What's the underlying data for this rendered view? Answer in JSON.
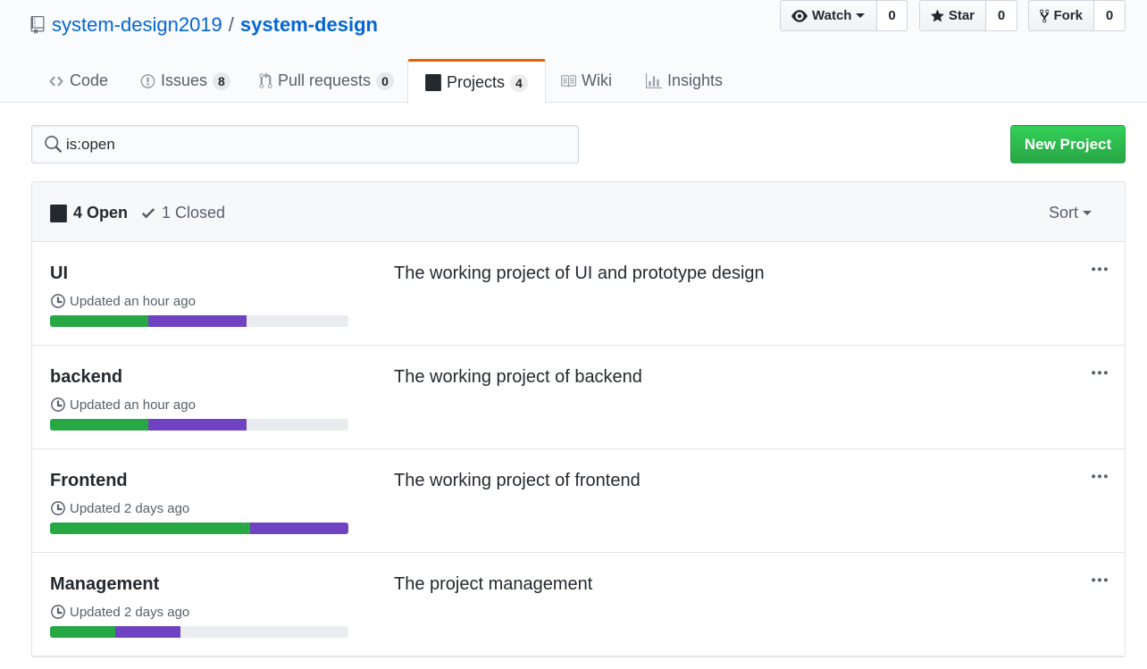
{
  "repo": {
    "owner": "system-design2019",
    "separator": "/",
    "name": "system-design"
  },
  "actions": {
    "watch": {
      "label": "Watch",
      "count": "0"
    },
    "star": {
      "label": "Star",
      "count": "0"
    },
    "fork": {
      "label": "Fork",
      "count": "0"
    }
  },
  "nav": {
    "code": {
      "label": "Code"
    },
    "issues": {
      "label": "Issues",
      "count": "8"
    },
    "pulls": {
      "label": "Pull requests",
      "count": "0"
    },
    "projects": {
      "label": "Projects",
      "count": "4"
    },
    "wiki": {
      "label": "Wiki"
    },
    "insights": {
      "label": "Insights"
    }
  },
  "search": {
    "value": "is:open"
  },
  "new_project_label": "New Project",
  "filters": {
    "open_label": "4 Open",
    "closed_label": "1 Closed",
    "sort_label": "Sort"
  },
  "projects": [
    {
      "name": "UI",
      "updated": "Updated an hour ago",
      "description": "The working project of UI and prototype design",
      "progress": {
        "done": 0.33,
        "in_progress": 0.33
      }
    },
    {
      "name": "backend",
      "updated": "Updated an hour ago",
      "description": "The working project of backend",
      "progress": {
        "done": 0.33,
        "in_progress": 0.33
      }
    },
    {
      "name": "Frontend",
      "updated": "Updated 2 days ago",
      "description": "The working project of frontend",
      "progress": {
        "done": 0.67,
        "in_progress": 0.33
      }
    },
    {
      "name": "Management",
      "updated": "Updated 2 days ago",
      "description": "The project management",
      "progress": {
        "done": 0.22,
        "in_progress": 0.22
      }
    }
  ],
  "colors": {
    "link": "#0366d6",
    "accent_tab": "#e36209",
    "progress_done": "#28a745",
    "progress_in_progress": "#6f42c1",
    "progress_todo": "#eaecef",
    "primary_button": "#28a745"
  },
  "icons": {
    "repo": "repo-icon",
    "watch": "eye-icon",
    "star": "star-icon",
    "fork": "repo-forked-icon",
    "code": "code-icon",
    "issues": "issue-opened-icon",
    "pulls": "git-pull-request-icon",
    "projects": "project-icon",
    "wiki": "book-icon",
    "insights": "graph-icon",
    "search": "search-icon",
    "closed": "check-icon",
    "updated": "clock-icon",
    "menu": "kebab-horizontal-icon"
  }
}
